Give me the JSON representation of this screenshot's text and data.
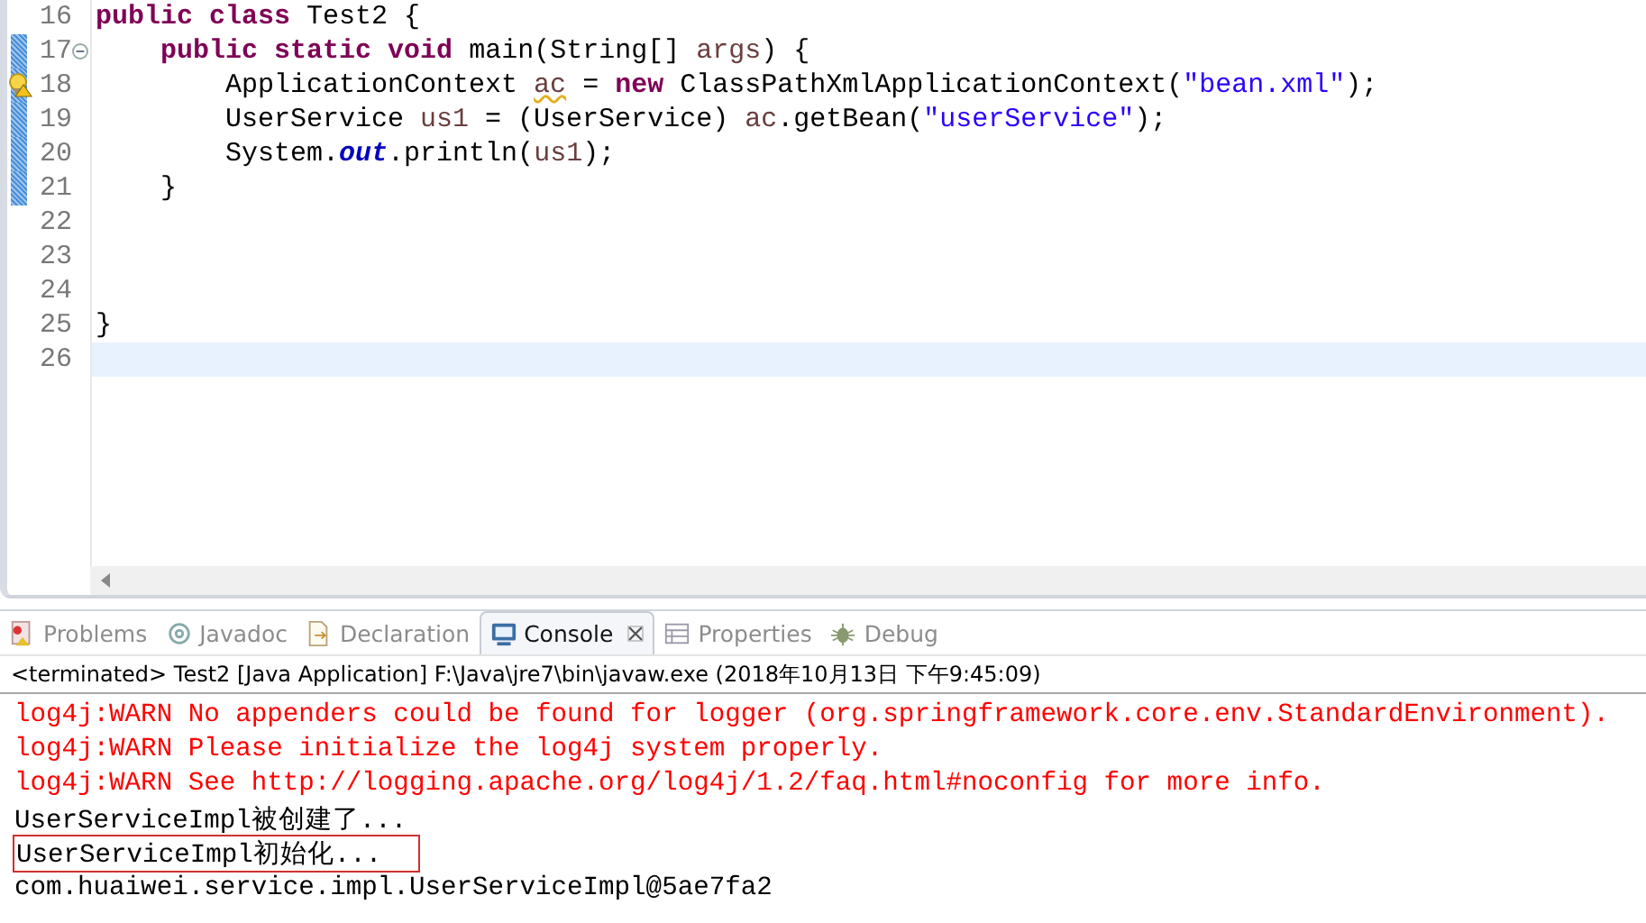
{
  "editor": {
    "lines": [
      {
        "number": "16",
        "changed": false,
        "foldable": false,
        "warning": false,
        "current": false,
        "tokens": [
          {
            "kind": "keyword",
            "text": "public "
          },
          {
            "kind": "keyword",
            "text": "class"
          },
          {
            "kind": "plain",
            "text": " Test2 {"
          }
        ]
      },
      {
        "number": "17",
        "changed": true,
        "foldable": true,
        "warning": false,
        "current": false,
        "tokens": [
          {
            "kind": "keyword",
            "text": "    public "
          },
          {
            "kind": "keyword",
            "text": "static "
          },
          {
            "kind": "keyword",
            "text": "void"
          },
          {
            "kind": "plain",
            "text": " main(String[] "
          },
          {
            "kind": "variable",
            "text": "args"
          },
          {
            "kind": "plain",
            "text": ") {"
          }
        ]
      },
      {
        "number": "18",
        "changed": true,
        "foldable": false,
        "warning": true,
        "current": false,
        "tokens": [
          {
            "kind": "plain",
            "text": "        ApplicationContext "
          },
          {
            "kind": "warned",
            "text": "ac"
          },
          {
            "kind": "plain",
            "text": " = "
          },
          {
            "kind": "keyword",
            "text": "new"
          },
          {
            "kind": "plain",
            "text": " ClassPathXmlApplicationContext("
          },
          {
            "kind": "string",
            "text": "\"bean.xml\""
          },
          {
            "kind": "plain",
            "text": ");"
          }
        ]
      },
      {
        "number": "19",
        "changed": true,
        "foldable": false,
        "warning": false,
        "current": false,
        "tokens": [
          {
            "kind": "plain",
            "text": "        UserService "
          },
          {
            "kind": "variable",
            "text": "us1"
          },
          {
            "kind": "plain",
            "text": " = (UserService) "
          },
          {
            "kind": "variable",
            "text": "ac"
          },
          {
            "kind": "plain",
            "text": ".getBean("
          },
          {
            "kind": "string",
            "text": "\"userService\""
          },
          {
            "kind": "plain",
            "text": ");"
          }
        ]
      },
      {
        "number": "20",
        "changed": true,
        "foldable": false,
        "warning": false,
        "current": false,
        "tokens": [
          {
            "kind": "plain",
            "text": "        System."
          },
          {
            "kind": "static",
            "text": "out"
          },
          {
            "kind": "plain",
            "text": ".println("
          },
          {
            "kind": "variable",
            "text": "us1"
          },
          {
            "kind": "plain",
            "text": ");"
          }
        ]
      },
      {
        "number": "21",
        "changed": true,
        "foldable": false,
        "warning": false,
        "current": false,
        "tokens": [
          {
            "kind": "plain",
            "text": "    }"
          }
        ]
      },
      {
        "number": "22",
        "changed": false,
        "foldable": false,
        "warning": false,
        "current": false
      },
      {
        "number": "23",
        "changed": false,
        "foldable": false,
        "warning": false,
        "current": false
      },
      {
        "number": "24",
        "changed": false,
        "foldable": false,
        "warning": false,
        "current": false
      },
      {
        "number": "25",
        "changed": false,
        "foldable": false,
        "warning": false,
        "current": false,
        "tokens": [
          {
            "kind": "plain",
            "text": "}"
          }
        ]
      },
      {
        "number": "26",
        "changed": false,
        "foldable": false,
        "warning": false,
        "current": true
      }
    ]
  },
  "tabs": [
    {
      "label": "Problems",
      "kind": "problems",
      "selected": false
    },
    {
      "label": "Javadoc",
      "kind": "javadoc",
      "selected": false
    },
    {
      "label": "Declaration",
      "kind": "declaration",
      "selected": false
    },
    {
      "label": "Console",
      "kind": "console",
      "selected": true
    },
    {
      "label": "Properties",
      "kind": "properties",
      "selected": false
    },
    {
      "label": "Debug",
      "kind": "debug",
      "selected": false
    }
  ],
  "console": {
    "header": "<terminated> Test2 [Java Application] F:\\Java\\jre7\\bin\\javaw.exe (2018年10月13日 下午9:45:09)",
    "lines": [
      {
        "kind": "stderr",
        "boxed": false,
        "text": "log4j:WARN No appenders could be found for logger (org.springframework.core.env.StandardEnvironment)."
      },
      {
        "kind": "stderr",
        "boxed": false,
        "text": "log4j:WARN Please initialize the log4j system properly."
      },
      {
        "kind": "stderr",
        "boxed": false,
        "text": "log4j:WARN See http://logging.apache.org/log4j/1.2/faq.html#noconfig for more info."
      },
      {
        "kind": "stdout",
        "boxed": false,
        "text": "UserServiceImpl被创建了..."
      },
      {
        "kind": "stdout",
        "boxed": true,
        "text": "UserServiceImpl初始化..."
      },
      {
        "kind": "stdout",
        "boxed": false,
        "text": "com.huaiwei.service.impl.UserServiceImpl@5ae7fa2"
      }
    ]
  }
}
